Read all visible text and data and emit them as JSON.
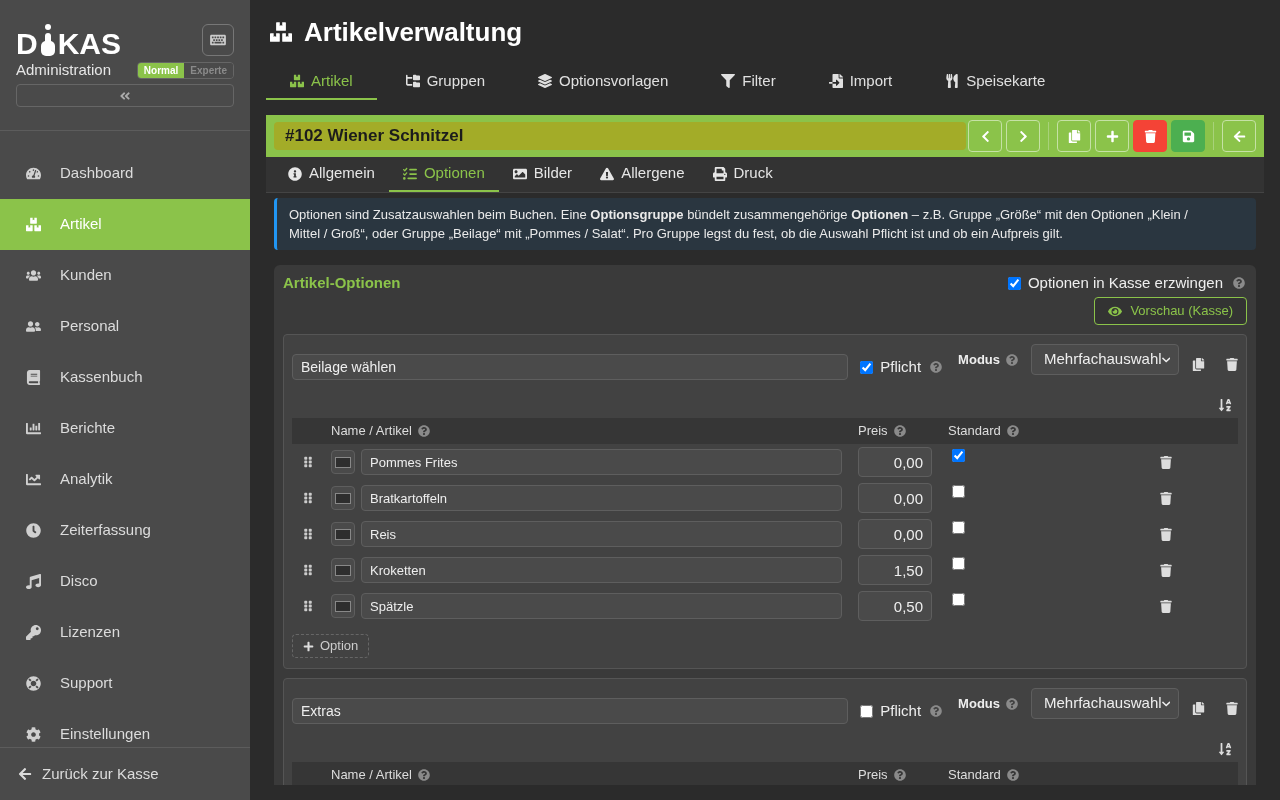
{
  "sidebar": {
    "logo": {
      "start": "D",
      "end": "KAS"
    },
    "subtitle": "Administration",
    "mode_toggle": [
      {
        "label": "Normal",
        "selected": true
      },
      {
        "label": "Experte",
        "selected": false
      }
    ],
    "items": [
      {
        "label": "Dashboard",
        "selected": false
      },
      {
        "label": "Artikel",
        "selected": true
      },
      {
        "label": "Kunden",
        "selected": false
      },
      {
        "label": "Personal",
        "selected": false
      },
      {
        "label": "Kassenbuch",
        "selected": false
      },
      {
        "label": "Berichte",
        "selected": false
      },
      {
        "label": "Analytik",
        "selected": false
      },
      {
        "label": "Zeiterfassung",
        "selected": false
      },
      {
        "label": "Disco",
        "selected": false
      },
      {
        "label": "Lizenzen",
        "selected": false
      },
      {
        "label": "Support",
        "selected": false
      },
      {
        "label": "Einstellungen",
        "selected": false
      }
    ],
    "footer_link": "Zurück zur Kasse"
  },
  "page": {
    "title": "Artikelverwaltung"
  },
  "tabs": [
    {
      "label": "Artikel",
      "selected": true
    },
    {
      "label": "Gruppen",
      "selected": false
    },
    {
      "label": "Optionsvorlagen",
      "selected": false
    },
    {
      "label": "Filter",
      "selected": false
    },
    {
      "label": "Import",
      "selected": false
    },
    {
      "label": "Speisekarte",
      "selected": false
    }
  ],
  "article": {
    "title": "#102 Wiener Schnitzel"
  },
  "subtabs": [
    {
      "label": "Allgemein",
      "selected": false
    },
    {
      "label": "Optionen",
      "selected": true
    },
    {
      "label": "Bilder",
      "selected": false
    },
    {
      "label": "Allergene",
      "selected": false
    },
    {
      "label": "Druck",
      "selected": false
    }
  ],
  "info": "Optionen sind Zusatzauswahlen beim Buchen. Eine **Optionsgruppe** bündelt zusammengehörige **Optionen** – z.B. Gruppe „Größe“ mit den Optionen „Klein / Mittel / Groß“, oder Gruppe „Beilage“ mit „Pommes / Salat“. Pro Gruppe legst du fest, ob die Auswahl Pflicht ist und ob ein Aufpreis gilt.",
  "options_card": {
    "title": "Artikel-Optionen",
    "force_in_register": {
      "label": "Optionen in Kasse erzwingen",
      "checked": true
    },
    "preview_button": "Vorschau (Kasse)",
    "groups": [
      {
        "name": "Beilage wählen",
        "required": {
          "label": "Pflicht",
          "checked": true
        },
        "mode_label": "Modus",
        "mode_value": "Mehrfachauswahl",
        "columns": [
          "Name / Artikel",
          "Preis",
          "Standard"
        ],
        "options": [
          {
            "name": "Pommes Frites",
            "price": "0,00",
            "default": true
          },
          {
            "name": "Bratkartoffeln",
            "price": "0,00",
            "default": false
          },
          {
            "name": "Reis",
            "price": "0,00",
            "default": false
          },
          {
            "name": "Kroketten",
            "price": "1,50",
            "default": false
          },
          {
            "name": "Spätzle",
            "price": "0,50",
            "default": false
          }
        ],
        "add_button": "Option"
      },
      {
        "name": "Extras",
        "required": {
          "label": "Pflicht",
          "checked": false
        },
        "mode_label": "Modus",
        "mode_value": "Mehrfachauswahl",
        "columns": [
          "Name / Artikel",
          "Preis",
          "Standard"
        ]
      }
    ]
  }
}
